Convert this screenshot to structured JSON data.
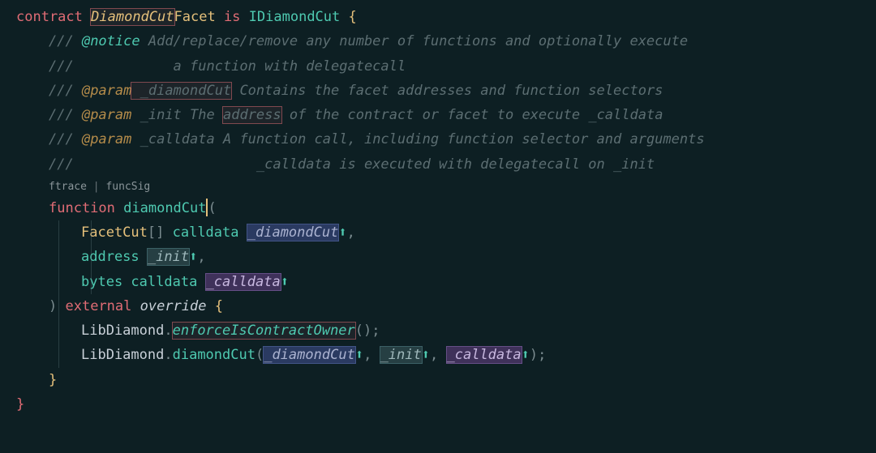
{
  "l1": {
    "contract": "contract",
    "name1": "DiamondCut",
    "name2": "Facet",
    "is": "is",
    "iface": "IDiamondCut",
    "open": " {"
  },
  "c1": {
    "slashes": "///",
    "tag": " @notice",
    "text": " Add/replace/remove any number of functions and optionally execute"
  },
  "c2": {
    "slashes": "///",
    "text": "            a function with delegatecall"
  },
  "c3": {
    "slashes": "///",
    "tag": " @param",
    "name": " _diamondCut",
    "text": " Contains the facet addresses and function selectors"
  },
  "c4": {
    "slashes": "///",
    "tag": " @param",
    "name": " _init",
    "text1": " The ",
    "addr": "address",
    "text2": " of the contract or facet to execute _calldata"
  },
  "c5": {
    "slashes": "///",
    "tag": " @param",
    "name": " _calldata",
    "text": " A function call, including function selector and arguments"
  },
  "c6": {
    "slashes": "///",
    "text": "                      _calldata is executed with delegatecall on _init"
  },
  "codelens": {
    "a": "ftrace",
    "sep": " | ",
    "b": "funcSig"
  },
  "sig": {
    "fn": "function",
    "name": "diamondCut",
    "open": "(",
    "p1_type": "FacetCut",
    "p1_arr": "[] ",
    "p1_loc": "calldata",
    "p1_name": "_diamondCut",
    "p2_type": "address",
    "p2_name": "_init",
    "p3_type": "bytes ",
    "p3_loc": "calldata",
    "p3_name": "_calldata",
    "close": ")",
    "ext": "external",
    "ovr": "override",
    "brace": " {"
  },
  "body": {
    "lib1": "LibDiamond",
    "dot": ".",
    "m1": "enforceIsContractOwner",
    "p1": "();",
    "lib2": "LibDiamond",
    "m2": "diamondCut",
    "open": "(",
    "a1": "_diamondCut",
    "c": ",",
    "sp": " ",
    "a2": "_init",
    "a3": "_calldata",
    "close": ");"
  },
  "close1": "}",
  "close2": "}",
  "arrow": "⬆"
}
